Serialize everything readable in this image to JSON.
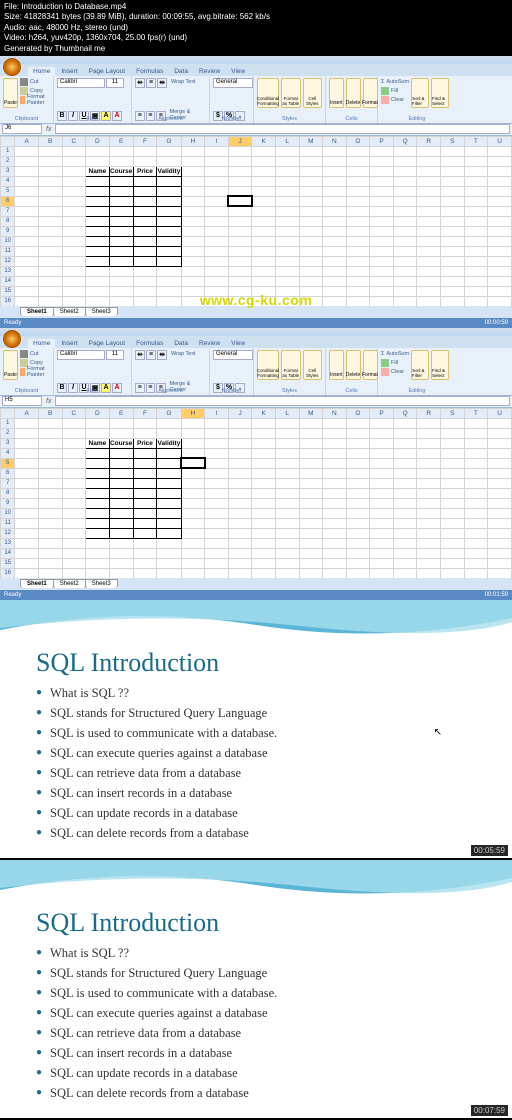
{
  "metadata": {
    "file": "File: Introduction to Database.mp4",
    "size": "Size: 41828341 bytes (39.89 MiB), duration: 00:09:55, avg.bitrate: 562 kb/s",
    "audio": "Audio: aac, 48000 Hz, stereo (und)",
    "video": "Video: h264, yuv420p, 1360x704, 25.00 fps(r) (und)",
    "generated": "Generated by Thumbnail me"
  },
  "excel": {
    "tabs": [
      "Home",
      "Insert",
      "Page Layout",
      "Formulas",
      "Data",
      "Review",
      "View"
    ],
    "active_tab": "Home",
    "clipboard": {
      "paste": "Paste",
      "cut": "Cut",
      "copy": "Copy",
      "fp": "Format Painter",
      "label": "Clipboard"
    },
    "font": {
      "name": "Calibri",
      "size": "11",
      "label": "Font"
    },
    "align": {
      "wrap": "Wrap Text",
      "merge": "Merge & Center",
      "label": "Alignment"
    },
    "number": {
      "fmt": "General",
      "label": "Number"
    },
    "styles": {
      "cf": "Conditional Formatting",
      "ft": "Format as Table",
      "cs": "Cell Styles",
      "label": "Styles"
    },
    "cells": {
      "ins": "Insert",
      "del": "Delete",
      "fmt": "Format",
      "label": "Cells"
    },
    "editing": {
      "sum": "AutoSum",
      "fill": "Fill",
      "clear": "Clear",
      "sort": "Sort & Filter",
      "find": "Find & Select",
      "label": "Editing"
    },
    "headers": [
      "Name",
      "Course",
      "Price",
      "Validity"
    ],
    "cols": [
      "A",
      "B",
      "C",
      "D",
      "E",
      "F",
      "G",
      "H",
      "I",
      "J",
      "K",
      "L",
      "M",
      "N",
      "O",
      "P",
      "Q",
      "R",
      "S",
      "T",
      "U"
    ],
    "sheets": [
      "Sheet1",
      "Sheet2",
      "Sheet3"
    ],
    "status": "Ready",
    "panel1": {
      "namebox": "J6",
      "sel_col": "J",
      "sel_row": 6,
      "time": "00:00:59"
    },
    "panel2": {
      "namebox": "H5",
      "sel_col": "H",
      "sel_row": 5,
      "time": "00:01:59"
    }
  },
  "watermark": "www.cg-ku.com",
  "slide": {
    "title": "SQL Introduction",
    "bullets": [
      "What is SQL ??",
      "SQL stands for Structured Query Language",
      "SQL is used to communicate with a database.",
      "SQL can execute queries against a database",
      "SQL can retrieve data from a database",
      "SQL can insert records in a database",
      "SQL can update records in a database",
      "SQL can delete records from a database"
    ],
    "time1": "00:05:59",
    "time2": "00:07:59"
  }
}
